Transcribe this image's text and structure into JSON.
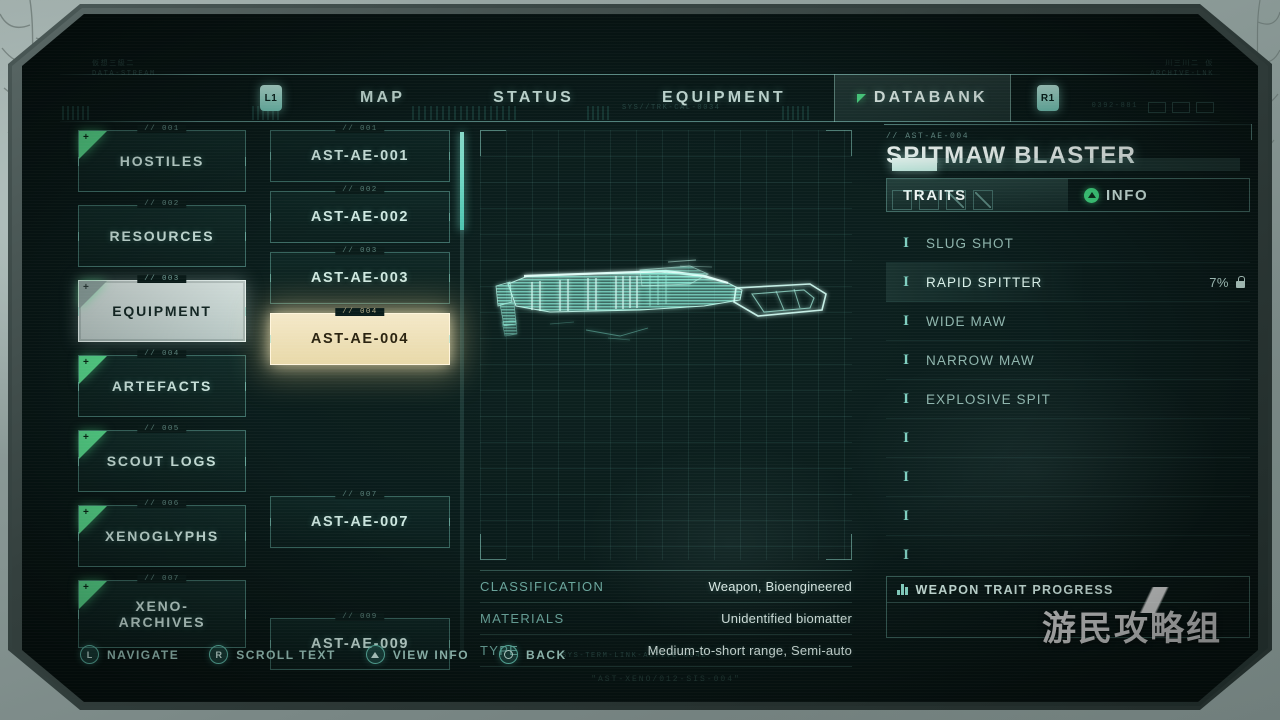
{
  "nav": {
    "left_bumper": "L1",
    "right_bumper": "R1",
    "tabs": [
      {
        "label": "MAP",
        "active": false,
        "flag": false
      },
      {
        "label": "STATUS",
        "active": false,
        "flag": false
      },
      {
        "label": "EQUIPMENT",
        "active": false,
        "flag": false
      },
      {
        "label": "DATABANK",
        "active": true,
        "flag": true
      }
    ]
  },
  "sidebar": {
    "items": [
      {
        "num": "// 001",
        "label": "HOSTILES",
        "new": true,
        "selected": false
      },
      {
        "num": "// 002",
        "label": "RESOURCES",
        "new": false,
        "selected": false
      },
      {
        "num": "// 003",
        "label": "EQUIPMENT",
        "new": true,
        "selected": true
      },
      {
        "num": "// 004",
        "label": "ARTEFACTS",
        "new": true,
        "selected": false
      },
      {
        "num": "// 005",
        "label": "SCOUT LOGS",
        "new": true,
        "selected": false
      },
      {
        "num": "// 006",
        "label": "XENOGLYPHS",
        "new": true,
        "selected": false
      },
      {
        "num": "// 007",
        "label": "XENO-\nARCHIVES",
        "new": true,
        "selected": false
      }
    ]
  },
  "entries": {
    "scroll_thumb_percent": 19,
    "items": [
      {
        "num": "// 001",
        "code": "AST-AE-001",
        "visible": true,
        "selected": false
      },
      {
        "num": "// 002",
        "code": "AST-AE-002",
        "visible": true,
        "selected": false
      },
      {
        "num": "// 003",
        "code": "AST-AE-003",
        "visible": true,
        "selected": false
      },
      {
        "num": "// 004",
        "code": "AST-AE-004",
        "visible": true,
        "selected": true
      },
      {
        "num": "",
        "code": "",
        "visible": false,
        "selected": false
      },
      {
        "num": "",
        "code": "",
        "visible": false,
        "selected": false
      },
      {
        "num": "// 007",
        "code": "AST-AE-007",
        "visible": true,
        "selected": false
      },
      {
        "num": "",
        "code": "",
        "visible": false,
        "selected": false
      },
      {
        "num": "// 009",
        "code": "AST-AE-009",
        "visible": true,
        "selected": false
      }
    ]
  },
  "viewer": {
    "model_name": "spitmaw-blaster-hologram"
  },
  "stats": {
    "rows": [
      {
        "key": "CLASSIFICATION",
        "value": "Weapon, Bioengineered"
      },
      {
        "key": "MATERIALS",
        "value": "Unidentified biomatter"
      },
      {
        "key": "TYPE",
        "value": "Medium-to-short range, Semi-auto"
      }
    ],
    "footnote": "\"AST-XENO/012-SIS-004\""
  },
  "detail": {
    "code": "// AST-AE-004",
    "title": "SPITMAW BLASTER",
    "tabs": [
      {
        "label": "TRAITS",
        "active": true,
        "icon": null
      },
      {
        "label": "INFO",
        "active": false,
        "icon": "triangle-button-icon"
      }
    ],
    "traits": [
      {
        "slot": "I",
        "name": "SLUG SHOT",
        "percent": "",
        "locked": false,
        "highlighted": false
      },
      {
        "slot": "I",
        "name": "RAPID SPITTER",
        "percent": "7%",
        "locked": true,
        "highlighted": true
      },
      {
        "slot": "I",
        "name": "WIDE MAW",
        "percent": "",
        "locked": false,
        "highlighted": false
      },
      {
        "slot": "I",
        "name": "NARROW MAW",
        "percent": "",
        "locked": false,
        "highlighted": false
      },
      {
        "slot": "I",
        "name": "EXPLOSIVE SPIT",
        "percent": "",
        "locked": false,
        "highlighted": false
      },
      {
        "slot": "I",
        "name": "",
        "percent": "",
        "locked": false,
        "highlighted": false
      },
      {
        "slot": "I",
        "name": "",
        "percent": "",
        "locked": false,
        "highlighted": false
      },
      {
        "slot": "I",
        "name": "",
        "percent": "",
        "locked": false,
        "highlighted": false
      },
      {
        "slot": "I",
        "name": "",
        "percent": "",
        "locked": false,
        "highlighted": false
      }
    ],
    "progress": {
      "label": "WEAPON TRAIT PROGRESS",
      "percent": 13,
      "slots": [
        {
          "filled": false
        },
        {
          "filled": false
        },
        {
          "filled": true
        },
        {
          "filled": true
        }
      ]
    }
  },
  "hints": [
    {
      "button": "L",
      "label": "NAVIGATE",
      "glyph": "stick-left-icon"
    },
    {
      "button": "R",
      "label": "SCROLL TEXT",
      "glyph": "stick-right-icon"
    },
    {
      "button": "",
      "label": "VIEW INFO",
      "glyph": "triangle-button-icon"
    },
    {
      "button": "",
      "label": "BACK",
      "glyph": "circle-button-icon"
    }
  ],
  "watermark": {
    "text": "游民攻略组"
  },
  "colors": {
    "accent_teal": "#8fe8d6",
    "accent_green": "#4fe08a",
    "selected_cream": "#f4e8c8",
    "panel_bg": "#0a1c1a",
    "text_primary": "#cfe9e2"
  }
}
